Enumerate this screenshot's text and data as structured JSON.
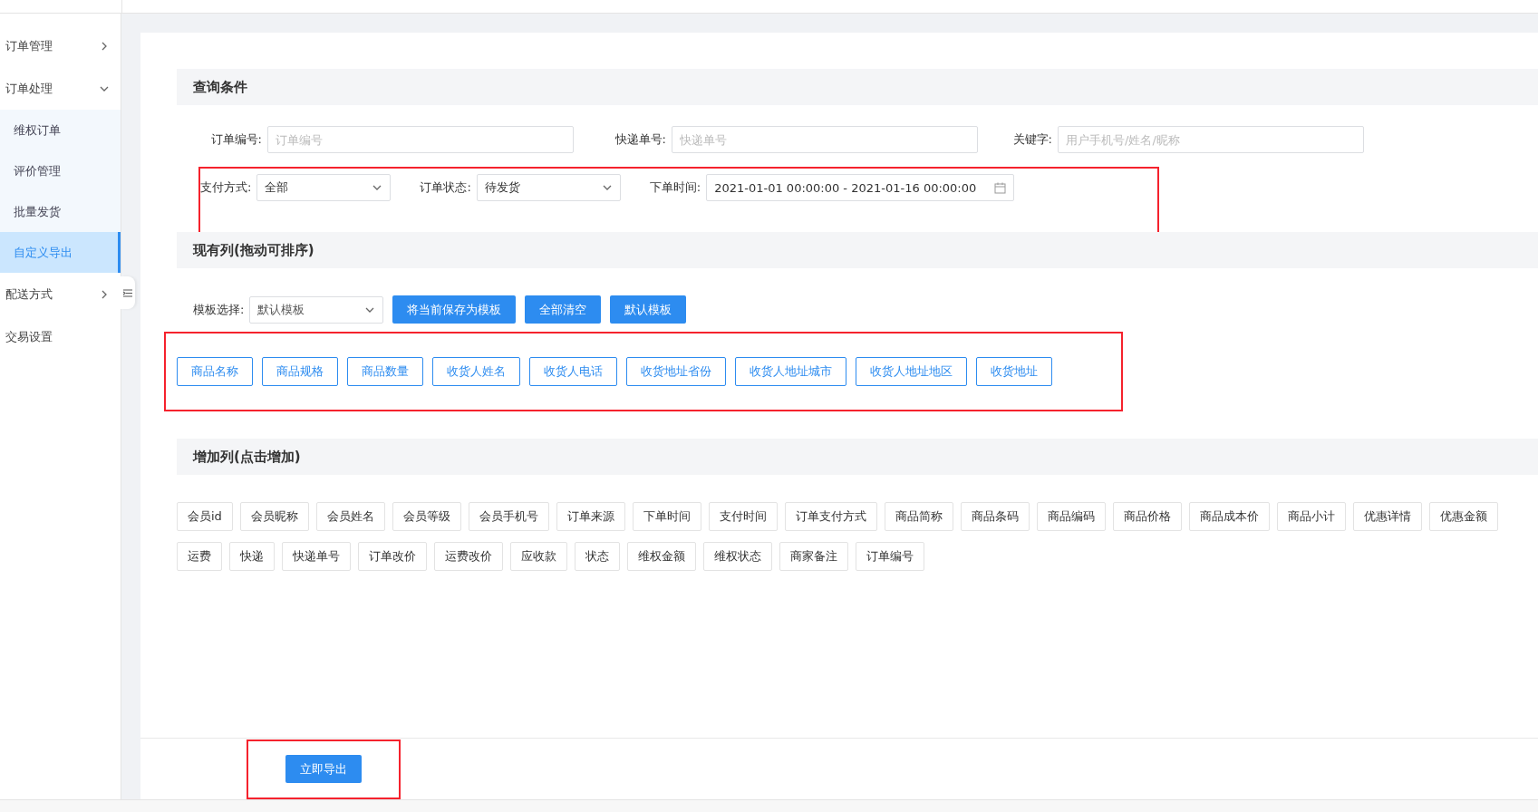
{
  "sidebar": {
    "items": [
      {
        "label": "订单管理",
        "expanded": false
      },
      {
        "label": "订单处理",
        "expanded": true,
        "children": [
          {
            "label": "维权订单",
            "selected": false
          },
          {
            "label": "评价管理",
            "selected": false
          },
          {
            "label": "批量发货",
            "selected": false
          },
          {
            "label": "自定义导出",
            "selected": true
          }
        ]
      },
      {
        "label": "配送方式",
        "expanded": false
      },
      {
        "label": "交易设置"
      }
    ]
  },
  "query": {
    "title": "查询条件",
    "row_1": [
      {
        "label": "订单编号:",
        "placeholder": "订单编号"
      },
      {
        "label": "快递单号:",
        "placeholder": "快递单号"
      },
      {
        "label": "关键字:",
        "placeholder": "用户手机号/姓名/昵称"
      }
    ],
    "row_2": {
      "highlighted": true,
      "fields": [
        {
          "kind": "select",
          "label": "支付方式:",
          "value": "全部"
        },
        {
          "kind": "select",
          "label": "订单状态:",
          "value": "待发货"
        },
        {
          "kind": "date",
          "label": "下单时间:",
          "value": "2021-01-01 00:00:00 - 2021-01-16 00:00:00"
        }
      ]
    }
  },
  "current_columns": {
    "title": "现有列(拖动可排序)",
    "template_label": "模板选择:",
    "template_value": "默认模板",
    "buttons": [
      "将当前保存为模板",
      "全部清空",
      "默认模板"
    ],
    "highlighted": true,
    "columns": [
      "商品名称",
      "商品规格",
      "商品数量",
      "收货人姓名",
      "收货人电话",
      "收货地址省份",
      "收货人地址城市",
      "收货人地址地区",
      "收货地址"
    ]
  },
  "add_columns": {
    "title": "增加列(点击增加)",
    "columns": [
      "会员id",
      "会员昵称",
      "会员姓名",
      "会员等级",
      "会员手机号",
      "订单来源",
      "下单时间",
      "支付时间",
      "订单支付方式",
      "商品简称",
      "商品条码",
      "商品编码",
      "商品价格",
      "商品成本价",
      "商品小计",
      "优惠详情",
      "优惠金额",
      "运费",
      "快递",
      "快递单号",
      "订单改价",
      "运费改价",
      "应收款",
      "状态",
      "维权金额",
      "维权状态",
      "商家备注",
      "订单编号"
    ]
  },
  "export": {
    "button": "立即导出",
    "highlighted": true
  }
}
